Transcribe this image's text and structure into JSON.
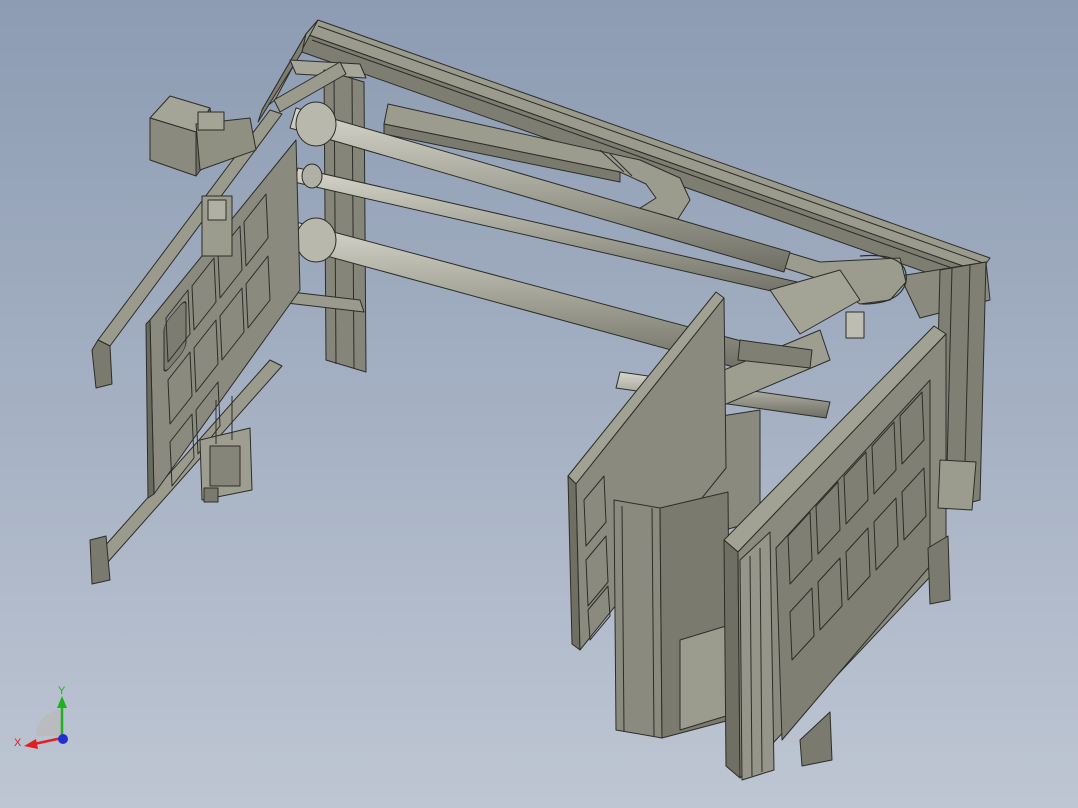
{
  "viewport": {
    "background_top": "#8d9cb3",
    "background_bottom": "#bec6d3",
    "model_color": "#8f8f82",
    "model_edge_color": "#2d2d28"
  },
  "triad": {
    "x_label": "X",
    "y_label": "Y",
    "x_color": "#e02020",
    "y_color": "#20b020",
    "z_color": "#2030d0"
  }
}
